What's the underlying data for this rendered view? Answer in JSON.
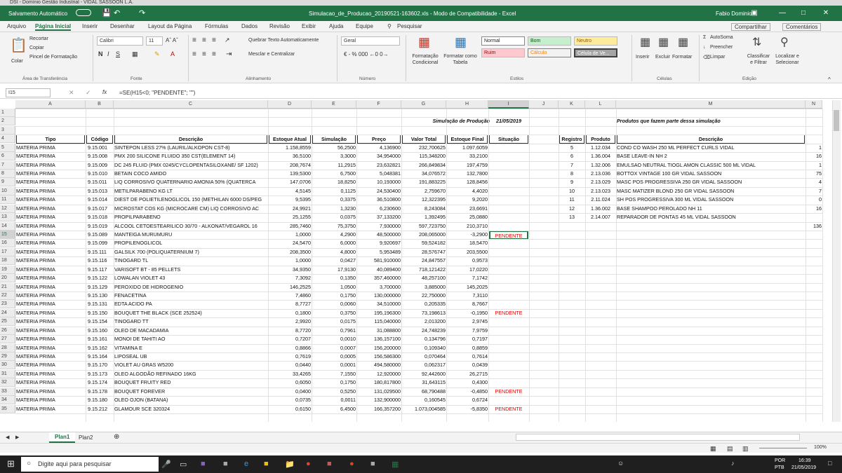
{
  "os_title": "DSI - Domínio Gestão Industrial - VIDAL SASSOON L.A.",
  "titlebar": {
    "autosave": "Salvamento Automático",
    "filename": "Simulacao_de_Producao_20190521-163602.xls  -  Modo de Compatibilidade  -  Excel",
    "user": "Fabio Dominio"
  },
  "tabs": [
    "Arquivo",
    "Página Inicial",
    "Inserir",
    "Desenhar",
    "Layout da Página",
    "Fórmulas",
    "Dados",
    "Revisão",
    "Exibir",
    "Ajuda",
    "Equipe"
  ],
  "search": "Pesquisar",
  "share": "Compartilhar",
  "comments": "Comentários",
  "ribbon": {
    "recortar": "Recortar",
    "copiar": "Copiar",
    "colar": "Colar",
    "pincel": "Pincel de Formatação",
    "area": "Área de Transferência",
    "font_name": "Calibri",
    "font_size": "11",
    "fonte": "Fonte",
    "quebrar": "Quebrar Texto Automaticamente",
    "mesclar": "Mesclar e Centralizar",
    "alinhamento": "Alinhamento",
    "format": "Geral",
    "numero": "Número",
    "fc": "Formatação Condicional",
    "ft": "Formatar como Tabela",
    "estilos": "Estilos",
    "s_normal": "Normal",
    "s_bom": "Bom",
    "s_neutro": "Neutro",
    "s_ruim": "Ruim",
    "s_calc": "Cálculo",
    "s_cel": "Célula de Ve...",
    "inserir": "Inserir",
    "excluir": "Excluir",
    "formatar": "Formatar",
    "celulas": "Células",
    "autosoma": "AutoSoma",
    "preencher": "Preencher",
    "limpar": "Limpar",
    "classificar": "Classificar e Filtrar",
    "localizar": "Localizar e Selecionar",
    "edicao": "Edição"
  },
  "namebox": "I15",
  "formula": "=SE(H15<0; \"PENDENTE\"; \"\")",
  "cols": [
    "A",
    "B",
    "C",
    "D",
    "E",
    "F",
    "G",
    "H",
    "I",
    "J",
    "K",
    "L",
    "M",
    "N"
  ],
  "sim_title": "Simulação de Produção",
  "sim_date": "21/05/2019",
  "prod_title": "Produtos que fazem parte dessa simulação",
  "headers": [
    "Tipo",
    "Código",
    "Descrição",
    "Estoque Atual",
    "Simulação",
    "Preço",
    "Valor Total",
    "Estoque Final",
    "Situação"
  ],
  "headers2": [
    "Registro",
    "Produto",
    "Descrição"
  ],
  "rows": [
    [
      "MATERIA PRIMA",
      "9.15.001",
      "SINTEPON LESS 27% (LAURIL/ALKOPON CST-8)",
      "1.158,8559",
      "56,2500",
      "4,136900",
      "232,700625",
      "1.097,6059",
      ""
    ],
    [
      "MATERIA PRIMA",
      "9.15.008",
      "PMX 200 SILICONE FLUIDO 350 CST(ELEMENT 14)",
      "36,5100",
      "3,3000",
      "34,954000",
      "115,348200",
      "33,2100",
      ""
    ],
    [
      "MATERIA PRIMA",
      "9.15.009",
      "DC 245 FLUID (PMX 0245/CYCLOPENTASILOXANE/ SF 1202)",
      "208,7674",
      "11,2915",
      "23,632821",
      "266,849834",
      "197,4759",
      ""
    ],
    [
      "MATERIA PRIMA",
      "9.15.010",
      "BETAIN COCO AMIDO",
      "139,5300",
      "6,7500",
      "5,048381",
      "34,076572",
      "132,7800",
      ""
    ],
    [
      "MATERIA PRIMA",
      "9.15.011",
      "LIQ CORROSIVO QUATERNARIO AMONIA 50% (QUATERCA",
      "147,0706",
      "18,8250",
      "10,193000",
      "191,883225",
      "128,8456",
      ""
    ],
    [
      "MATERIA PRIMA",
      "9.15.013",
      "METILPARABENO  KG LT",
      "4,5145",
      "0,1125",
      "24,530400",
      "2,759670",
      "4,4020",
      ""
    ],
    [
      "MATERIA PRIMA",
      "9.15.014",
      "DIEST DE POLIETILENOGLICOL 150 (METHILAN 6000 DS/PEG",
      "9,5395",
      "0,3375",
      "36,510800",
      "12,322395",
      "9,2020",
      ""
    ],
    [
      "MATERIA PRIMA",
      "9.15.017",
      "MICROSTAT COS KG (MICROCARE CM) LIQ CORROSIVO AC",
      "24,9921",
      "1,3230",
      "6,230600",
      "8,243084",
      "23,6691",
      ""
    ],
    [
      "MATERIA PRIMA",
      "9.15.018",
      "PROPILPARABENO",
      "25,1255",
      "0,0375",
      "37,133200",
      "1,392495",
      "25,0880",
      ""
    ],
    [
      "MATERIA PRIMA",
      "9.15.019",
      "ALCOOL CETOESTEARILICO 30/70 - ALKONAT/VEGAROL 16",
      "285,7460",
      "75,3750",
      "7,930000",
      "597,723750",
      "210,3710",
      ""
    ],
    [
      "MATERIA PRIMA",
      "9.15.089",
      "MANTEIGA MURUMURU",
      "1,0000",
      "4,2900",
      "48,500000",
      "208,065000",
      "-3,2900",
      "PENDENTE"
    ],
    [
      "MATERIA PRIMA",
      "9.15.099",
      "PROPILENOGLICOL",
      "24,5470",
      "6,0000",
      "9,920697",
      "59,524182",
      "18,5470",
      ""
    ],
    [
      "MATERIA PRIMA",
      "9.15.111",
      "GALSILK 700 (POLIQUATERNIUM 7)",
      "208,3500",
      "4,8000",
      "5,953489",
      "28,576747",
      "203,5500",
      ""
    ],
    [
      "MATERIA PRIMA",
      "9.15.116",
      "TINOGARD TL",
      "1,0000",
      "0,0427",
      "581,910000",
      "24,847557",
      "0,9573",
      ""
    ],
    [
      "MATERIA PRIMA",
      "9.15.117",
      "VARISOFT BT - 85 PELLETS",
      "34,9350",
      "17,9130",
      "40,089400",
      "718,121422",
      "17,0220",
      ""
    ],
    [
      "MATERIA PRIMA",
      "9.15.122",
      "LOWALAN VIOLET 43",
      "7,3092",
      "0,1350",
      "357,460000",
      "48,257100",
      "7,1742",
      ""
    ],
    [
      "MATERIA PRIMA",
      "9.15.129",
      "PEROXIDO DE HIDROGENIO",
      "146,2525",
      "1,0500",
      "3,700000",
      "3,885000",
      "145,2025",
      ""
    ],
    [
      "MATERIA PRIMA",
      "9.15.130",
      "FENACETINA",
      "7,4860",
      "0,1750",
      "130,000000",
      "22,750000",
      "7,3110",
      ""
    ],
    [
      "MATERIA PRIMA",
      "9.15.131",
      "EDTA ACIDO PA",
      "8,7727",
      "0,0060",
      "34,510000",
      "0,205335",
      "8,7667",
      ""
    ],
    [
      "MATERIA PRIMA",
      "9.15.150",
      "BOUQUET THE BLACK (SCE 252524)",
      "0,1800",
      "0,3750",
      "195,196300",
      "73,198613",
      "-0,1950",
      "PENDENTE"
    ],
    [
      "MATERIA PRIMA",
      "9.15.154",
      "TINOGARD TT",
      "2,9920",
      "0,0175",
      "115,040000",
      "2,013200",
      "2,9745",
      ""
    ],
    [
      "MATERIA PRIMA",
      "9.15.160",
      "OLEO DE MACADAMIA",
      "8,7720",
      "0,7961",
      "31,088800",
      "24,748239",
      "7,9759",
      ""
    ],
    [
      "MATERIA PRIMA",
      "9.15.161",
      "MONOI DE TAHITI AO",
      "0,7207",
      "0,0010",
      "136,157100",
      "0,134796",
      "0,7197",
      ""
    ],
    [
      "MATERIA PRIMA",
      "9.15.162",
      "VITAMINA E",
      "0,8866",
      "0,0007",
      "156,200000",
      "0,109340",
      "0,8859",
      ""
    ],
    [
      "MATERIA PRIMA",
      "9.15.164",
      "LIPOSEAL UB",
      "0,7619",
      "0,0005",
      "156,586300",
      "0,070464",
      "0,7614",
      ""
    ],
    [
      "MATERIA PRIMA",
      "9.15.170",
      "VIOLET AU GRAS W5200",
      "0,0440",
      "0,0001",
      "494,580000",
      "0,062317",
      "0,0439",
      ""
    ],
    [
      "MATERIA PRIMA",
      "9.15.173",
      "OLEO ALGODÃO REFINADO 16KG",
      "33,4265",
      "7,1550",
      "12,920000",
      "92,442600",
      "26,2715",
      ""
    ],
    [
      "MATERIA PRIMA",
      "9.15.174",
      "BOUQUET FRUITY RED",
      "0,6050",
      "0,1750",
      "180,817800",
      "31,643115",
      "0,4300",
      ""
    ],
    [
      "MATERIA PRIMA",
      "9.15.178",
      "BOUQUET FOREVER",
      "0,0400",
      "0,5250",
      "131,029500",
      "68,790488",
      "-0,4850",
      "PENDENTE"
    ],
    [
      "MATERIA PRIMA",
      "9.15.180",
      "OLEO OJON (BATANA)",
      "0,0735",
      "0,0011",
      "132,900000",
      "0,160545",
      "0,6724",
      ""
    ],
    [
      "MATERIA PRIMA",
      "9.15.212",
      "GLAMOUR SCE 320324",
      "0,6150",
      "6,4500",
      "166,357200",
      "1.073,004585",
      "-5,8350",
      "PENDENTE"
    ]
  ],
  "products": [
    [
      "5",
      "1.12.034",
      "COND CO WASH 250 ML PERFECT CURLS VIDAL",
      "1"
    ],
    [
      "6",
      "1.36.004",
      "BASE LEAVE-IN NH 2",
      "16"
    ],
    [
      "7",
      "1.32.006",
      "EMULSAO NEUTRAL TIOGL AMON CLASSIC 500 ML VIDAL",
      "1"
    ],
    [
      "8",
      "2.13.036",
      "BOTTOX VINTAGE 100 GR VIDAL SASSOON",
      "75"
    ],
    [
      "9",
      "2.13.029",
      "MASC POS PROGRESSIVA 250 GR VIDAL SASSOON",
      "4"
    ],
    [
      "10",
      "2.13.023",
      "MASC MATIZER BLOND 250 GR VIDAL SASSOON",
      "7"
    ],
    [
      "11",
      "2.11.024",
      "SH POS PROGRESSIVA 300 ML VIDAL SASSOON",
      "0"
    ],
    [
      "12",
      "1.36.002",
      "BASE SHAMPOO PEROLADO NH 11",
      "16"
    ],
    [
      "13",
      "2.14.007",
      "REPARADOR DE PONTAS 45 ML VIDAL SASSOON",
      ""
    ],
    [
      "",
      "",
      "",
      "136"
    ]
  ],
  "sheets": [
    "Plan1",
    "Plan2"
  ],
  "zoom": "100%",
  "taskbar": {
    "search": "Digite aqui para pesquisar",
    "lang1": "POR",
    "lang2": "PTB",
    "time": "16:39",
    "date": "21/05/2019"
  }
}
